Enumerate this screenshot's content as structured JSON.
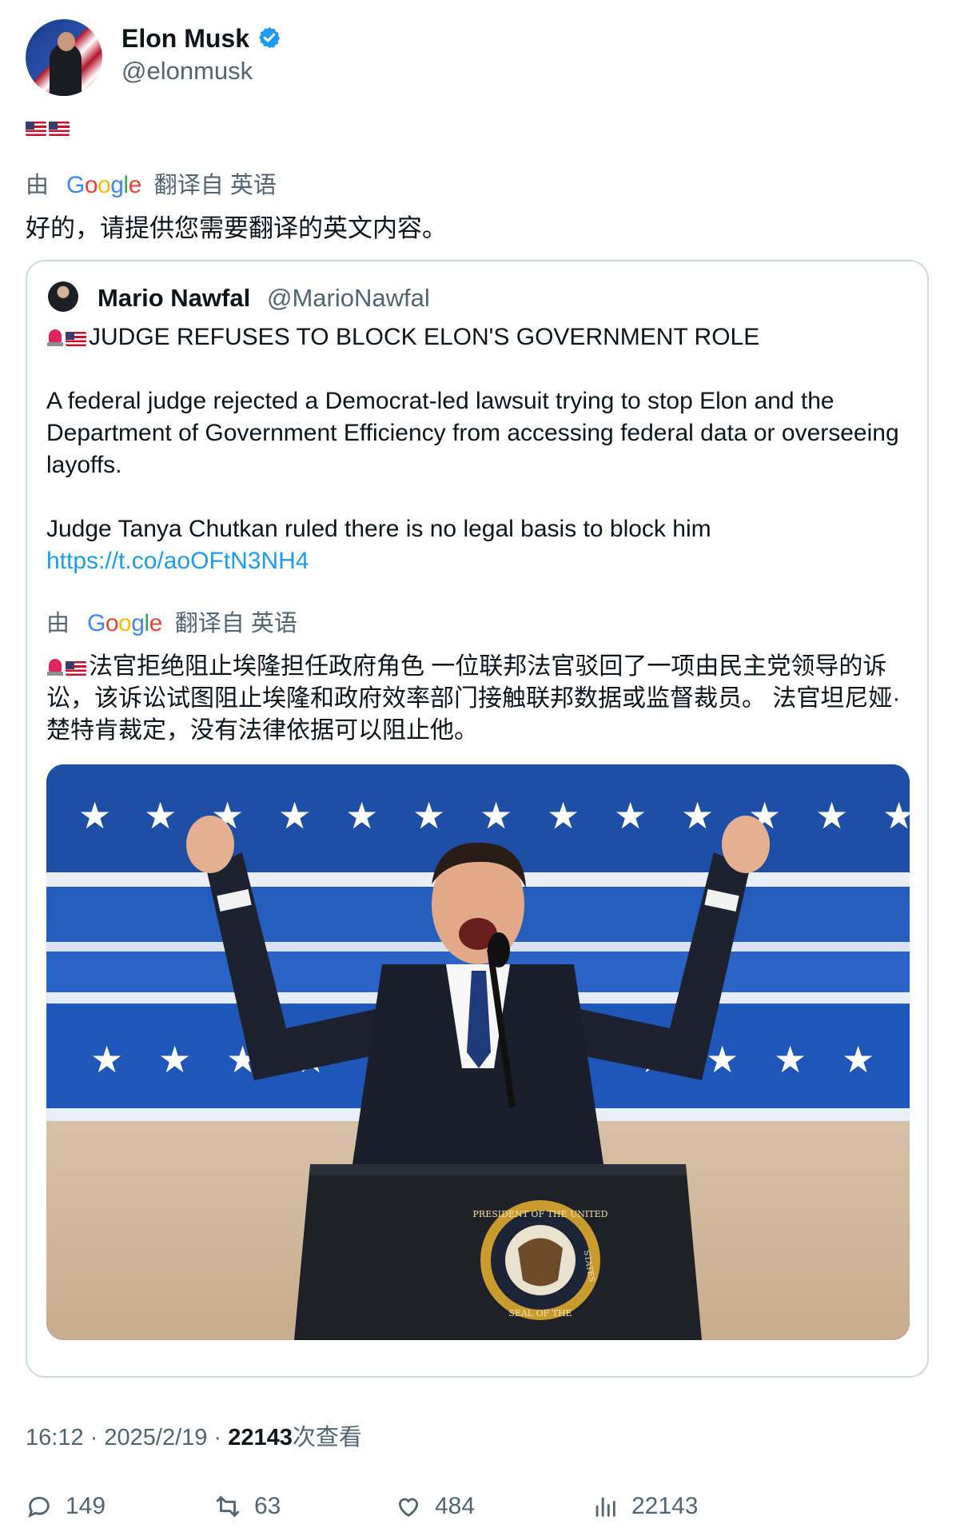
{
  "author": {
    "display_name": "Elon Musk",
    "handle": "@elonmusk",
    "verified": true,
    "verified_color": "#1d9bf0"
  },
  "tweet": {
    "text_emojis": [
      "us-flag",
      "us-flag"
    ],
    "translate": {
      "prefix": "由",
      "brand": "Google",
      "suffix": "翻译自 英语"
    },
    "translated_text": "好的，请提供您需要翻译的英文内容。"
  },
  "quote": {
    "display_name": "Mario Nawfal",
    "handle": "@MarioNawfal",
    "headline": "JUDGE REFUSES TO BLOCK ELON'S GOVERNMENT ROLE",
    "paragraph1": "A federal judge rejected a Democrat-led lawsuit trying to stop Elon and the Department of Government Efficiency from accessing federal data or overseeing layoffs.",
    "paragraph2": "Judge Tanya Chutkan ruled there is no legal basis to block him",
    "link": "https://t.co/aoOFtN3NH4",
    "translate": {
      "prefix": "由",
      "brand": "Google",
      "suffix": "翻译自 英语"
    },
    "translated_text": "法官拒绝阻止埃隆担任政府角色 一位联邦法官驳回了一项由民主党领导的诉讼，该诉讼试图阻止埃隆和政府效率部门接触联邦数据或监督裁员。 法官坦尼娅·楚特肯裁定，没有法律依据可以阻止他。",
    "seal_text_top": "PRESIDENT OF THE UNITED",
    "seal_text_bottom": "SEAL OF THE",
    "seal_text_right": "STATES"
  },
  "meta": {
    "time": "16:12",
    "separator": "·",
    "date": "2025/2/19",
    "views_count": "22143",
    "views_label": "次查看"
  },
  "actions": {
    "replies": "149",
    "retweets": "63",
    "likes": "484",
    "views": "22143"
  },
  "colors": {
    "text": "#0f1419",
    "secondary": "#536471",
    "link": "#1d9bf0",
    "border": "#cfd9de"
  }
}
